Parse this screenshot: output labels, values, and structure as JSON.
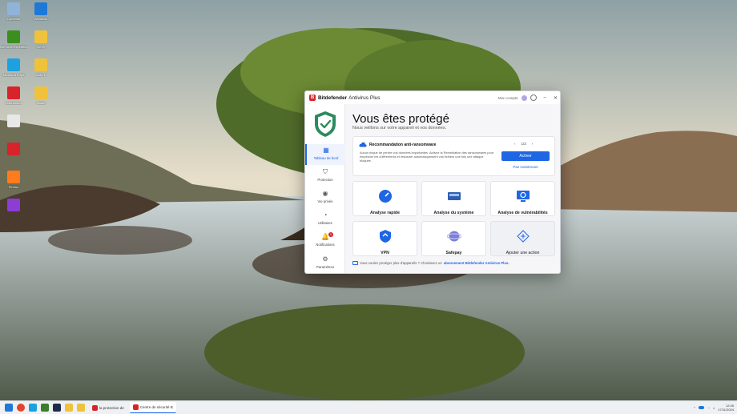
{
  "desktop": {
    "icons": [
      {
        "label": "Corbeille",
        "color": "#8fb3d9"
      },
      {
        "label": "Windows",
        "color": "#1e78d7"
      },
      {
        "label": "GeForce Experience",
        "color": "#3b8f1d"
      },
      {
        "label": "DIRS",
        "color": "#f0c23b"
      },
      {
        "label": "Microsoft Edge",
        "color": "#1ea1e0"
      },
      {
        "label": "auto 1",
        "color": "#f0c23b"
      },
      {
        "label": "Dashboard",
        "color": "#d8232a"
      },
      {
        "label": "install",
        "color": "#f0c23b"
      },
      {
        "label": "",
        "color": "#e8e8e8"
      },
      {
        "label": "",
        "color": "#d8232a"
      },
      {
        "label": "Firefox",
        "color": "#ff7b1c"
      },
      {
        "label": "",
        "color": "#8b3dd6"
      }
    ]
  },
  "app": {
    "brand": "Bitdefender",
    "product": "Antivirus Plus",
    "account_label": "Mon compte",
    "window_controls": [
      "–",
      "✕"
    ],
    "headline": "Vous êtes protégé",
    "subheadline": "Nous veillons sur votre appareil et vos données.",
    "sidebar": [
      {
        "label": "Tableau de bord",
        "icon": "dashboard-icon",
        "active": true
      },
      {
        "label": "Protection",
        "icon": "protection-shield-icon"
      },
      {
        "label": "Vie privée",
        "icon": "privacy-eye-icon"
      },
      {
        "label": "Utilitaires",
        "icon": "utilities-icon"
      },
      {
        "label": "Notifications",
        "icon": "bell-icon",
        "badge": "1"
      },
      {
        "label": "Paramètres",
        "icon": "gear-icon"
      }
    ],
    "recommendation": {
      "title": "Recommandation anti-ransomware",
      "text": "Aucun risque de perdre vos données importantes. Activez la Remédiation des ransomwares pour empêcher les chiffrements et restaurer automatiquement vos fichiers une fois une attaque bloquée.",
      "pager": "1/3",
      "prev": "‹",
      "next": "›",
      "primary": "Activer",
      "secondary": "Pas maintenant"
    },
    "tiles": [
      {
        "label": "Analyse rapide",
        "icon": "quick-scan-icon"
      },
      {
        "label": "Analyse du système",
        "icon": "system-scan-icon"
      },
      {
        "label": "Analyse de vulnérabilités",
        "icon": "vulnerability-scan-icon"
      },
      {
        "label": "VPN",
        "icon": "vpn-icon"
      },
      {
        "label": "Safepay",
        "icon": "safepay-icon"
      },
      {
        "label": "Ajouter une action",
        "icon": "add-action-icon"
      }
    ],
    "footer_text": "Vous voulez protéger plus d'appareils ? Choisissez un",
    "footer_link": "abonnement Bitdefender Antivirus Plus."
  },
  "taskbar": {
    "items": [
      {
        "label": "la protection de",
        "color": "#d8232a"
      },
      {
        "label": "Centre de sécurité B",
        "color": "#d8232a",
        "active": true
      }
    ],
    "clock_time": "12:45",
    "clock_date": "17/11/2024"
  },
  "colors": {
    "accent": "#1e66e4",
    "brand": "#d8232a",
    "shield": "#2d8a5e"
  }
}
